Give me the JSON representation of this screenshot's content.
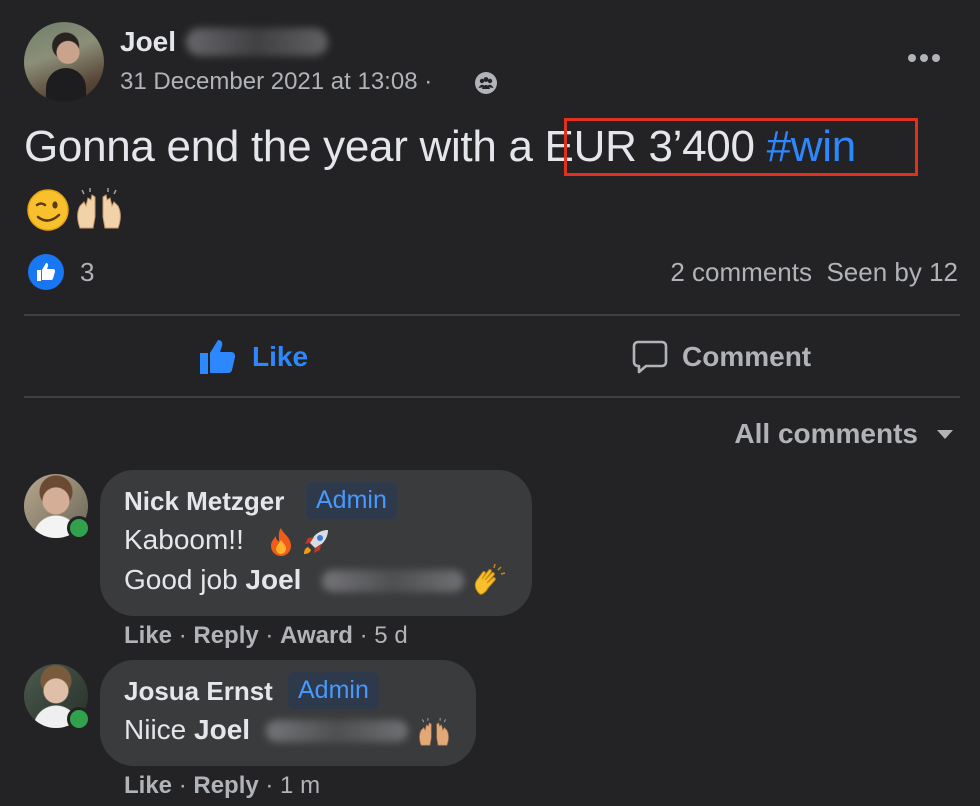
{
  "post": {
    "author": "Joel",
    "date": "31 December 2021 at 13:08 ·",
    "text_before": "Gonna end the year with a ",
    "text_highlight": "EUR 3’400",
    "hashtag": "#win",
    "emojis": [
      "wink-emoji",
      "raised-hands-emoji"
    ],
    "reaction_count": "3",
    "comments_count": "2 comments",
    "seen_by": "Seen by 12"
  },
  "actions": {
    "like_label": "Like",
    "comment_label": "Comment"
  },
  "comments_filter": "All comments",
  "comments": [
    {
      "name": "Nick Metzger",
      "badge": "Admin",
      "line1": "Kaboom!!",
      "line2_prefix": "Good job ",
      "mention": "Joel",
      "like": "Like",
      "reply": "Reply",
      "award": "Award",
      "time": "5 d"
    },
    {
      "name": "Josua Ernst",
      "badge": "Admin",
      "line1_prefix": "Niice ",
      "mention": "Joel",
      "like": "Like",
      "reply": "Reply",
      "time": "1 m"
    }
  ],
  "colors": {
    "background": "#232325",
    "accent": "#2d88ff",
    "highlight_border": "#e0301e",
    "online": "#31a24c"
  }
}
